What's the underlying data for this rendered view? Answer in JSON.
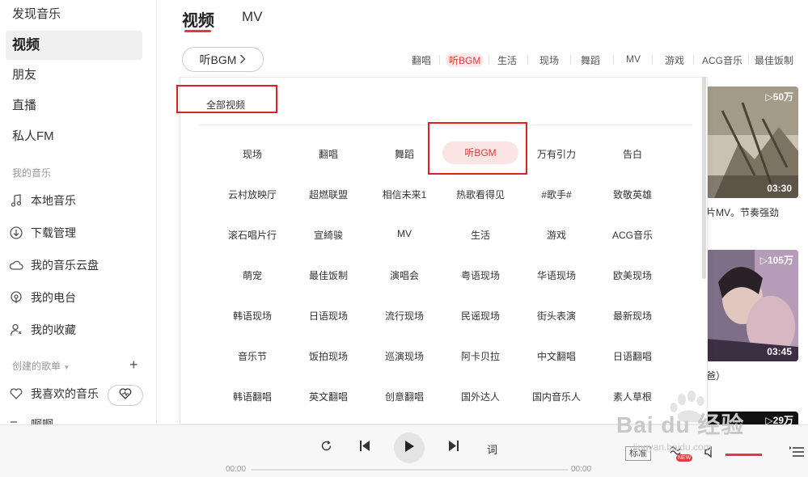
{
  "sidebar": {
    "nav": [
      "发现音乐",
      "视频",
      "朋友",
      "直播",
      "私人FM"
    ],
    "my_music_title": "我的音乐",
    "my_music": [
      "本地音乐",
      "下载管理",
      "我的音乐云盘",
      "我的电台",
      "我的收藏"
    ],
    "created_title": "创建的歌单",
    "liked": "我喜欢的音乐",
    "cut_item": "啊啊"
  },
  "tabs": {
    "video": "视频",
    "mv": "MV"
  },
  "bgm_button": "听BGM",
  "tag_bar": [
    "翻唱",
    "听BGM",
    "生活",
    "现场",
    "舞蹈",
    "MV",
    "游戏",
    "ACG音乐",
    "最佳饭制"
  ],
  "panel": {
    "all_label": "全部视频",
    "categories": [
      [
        "现场",
        "翻唱",
        "舞蹈",
        "听BGM",
        "万有引力",
        "告白"
      ],
      [
        "云村放映厅",
        "超燃联盟",
        "相信未来1",
        "热歌看得见",
        "#歌手#",
        "致敬英雄"
      ],
      [
        "滚石唱片行",
        "宣綺骏",
        "MV",
        "生活",
        "游戏",
        "ACG音乐"
      ],
      [
        "萌宠",
        "最佳饭制",
        "演唱会",
        "粤语现场",
        "华语现场",
        "欧美现场"
      ],
      [
        "韩语现场",
        "日语现场",
        "流行现场",
        "民谣现场",
        "街头表演",
        "最新现场"
      ],
      [
        "音乐节",
        "饭拍现场",
        "巡演现场",
        "阿卡贝拉",
        "中文翻唱",
        "日语翻唱"
      ],
      [
        "韩语翻唱",
        "英文翻唱",
        "创意翻唱",
        "国外达人",
        "国内音乐人",
        "素人草根"
      ]
    ]
  },
  "thumbs": [
    {
      "count": "▷50万",
      "duration": "03:30",
      "caption": "片MV。节奏强劲"
    },
    {
      "count": "▷105万",
      "duration": "03:45",
      "caption": "爸）"
    },
    {
      "count": "▷29万"
    }
  ],
  "player": {
    "lyric": "词",
    "time_start": "00:00",
    "time_end": "00:00",
    "quality": "标准",
    "new": "NEW"
  },
  "watermark": {
    "brand": "Bai du 经验",
    "sub": "jingyan.baidu.com"
  },
  "colors": {
    "accent": "#e03a3a",
    "annotation": "#e02020"
  }
}
